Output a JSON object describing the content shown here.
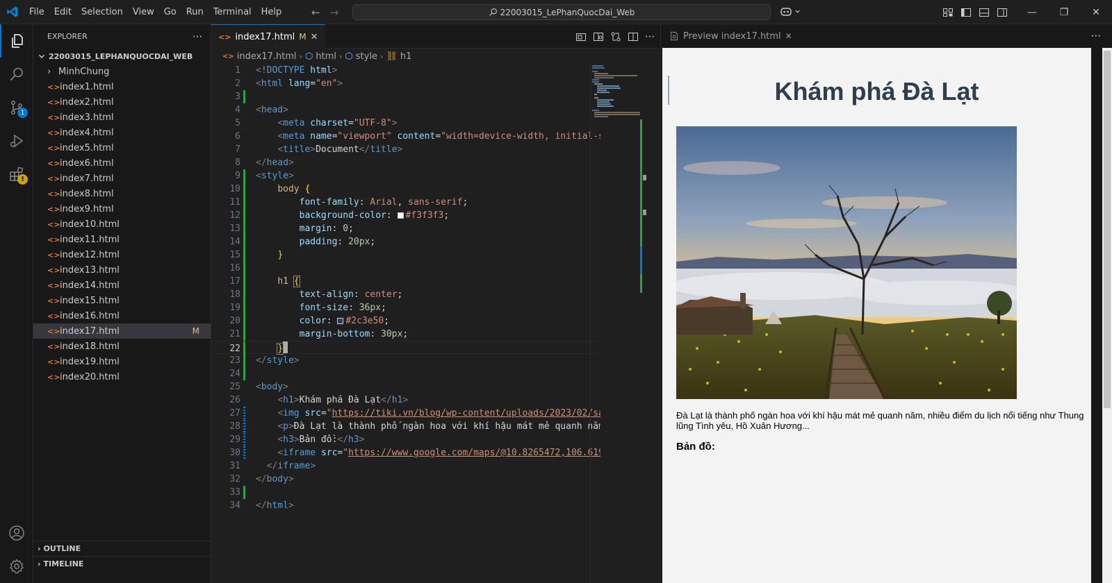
{
  "titlebar": {
    "menu": [
      "File",
      "Edit",
      "Selection",
      "View",
      "Go",
      "Run",
      "Terminal",
      "Help"
    ],
    "search_text": "22003015_LePhanQuocDai_Web"
  },
  "activity": {
    "scm_badge": "1"
  },
  "explorer": {
    "header": "EXPLORER",
    "more": "···",
    "root": "22003015_LEPHANQUOCDAI_WEB",
    "folder": "MinhChung",
    "files": [
      "index1.html",
      "index2.html",
      "index3.html",
      "index4.html",
      "index5.html",
      "index6.html",
      "index7.html",
      "index8.html",
      "index9.html",
      "index10.html",
      "index11.html",
      "index12.html",
      "index13.html",
      "index14.html",
      "index15.html",
      "index16.html",
      "index17.html",
      "index18.html",
      "index19.html",
      "index20.html"
    ],
    "selected_file": "index17.html",
    "selected_marker": "M",
    "outline": "OUTLINE",
    "timeline": "TIMELINE"
  },
  "editor": {
    "tab_label": "index17.html",
    "tab_marker": "M",
    "breadcrumb": [
      "index17.html",
      "html",
      "style",
      "h1"
    ],
    "current_line": 22
  },
  "preview": {
    "tab_label": "Preview index17.html",
    "heading": "Khám phá Đà Lạt",
    "paragraph": "Đà Lạt là thành phố ngàn hoa với khí hậu mát mẻ quanh năm, nhiều điểm du lịch nổi tiếng như Thung lũng Tình yêu, Hồ Xuân Hương...",
    "map_heading": "Bản đồ:"
  },
  "colors": {
    "accent": "#0078d4",
    "heading": "#2c3e50",
    "preview_bg": "#f3f3f3",
    "modified": "#e2c08d"
  }
}
